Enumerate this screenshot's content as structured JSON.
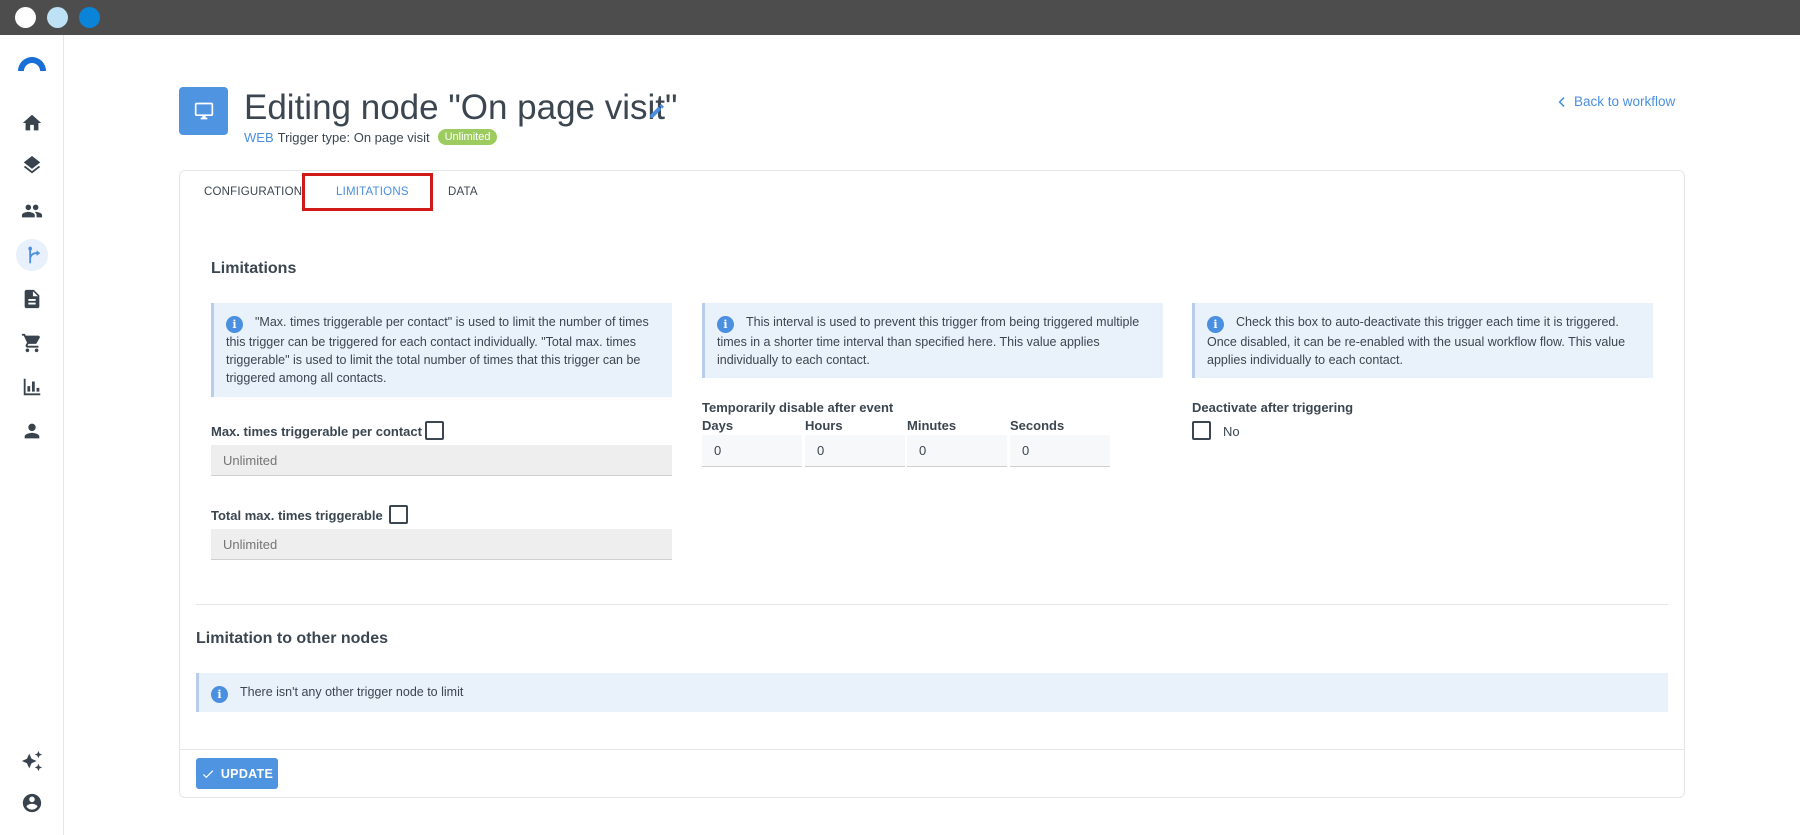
{
  "header": {
    "title": "Editing node \"On page visit\"",
    "channel": "WEB",
    "trigger_type": "Trigger type: On page visit",
    "badge": "Unlimited",
    "back_link": "Back to workflow"
  },
  "tabs": [
    {
      "label": "CONFIGURATION"
    },
    {
      "label": "LIMITATIONS"
    },
    {
      "label": "DATA"
    }
  ],
  "limitations": {
    "title": "Limitations",
    "info_max": "\"Max. times triggerable per contact\" is used to limit the number of times this trigger can be triggered for each contact individually. \"Total max. times triggerable\" is used to limit the total number of times that this trigger can be triggered among all contacts.",
    "info_interval": "This interval is used to prevent this trigger from being triggered multiple times in a shorter time interval than specified here. This value applies individually to each contact.",
    "info_deactivate": "Check this box to auto-deactivate this trigger each time it is triggered. Once disabled, it can be re-enabled with the usual workflow flow. This value applies individually to each contact.",
    "max_per_contact_label": "Max. times triggerable per contact",
    "max_per_contact_placeholder": "Unlimited",
    "total_max_label": "Total max. times triggerable",
    "total_max_placeholder": "Unlimited",
    "temp_disable_label": "Temporarily disable after event",
    "days_label": "Days",
    "hours_label": "Hours",
    "minutes_label": "Minutes",
    "seconds_label": "Seconds",
    "days_value": "0",
    "hours_value": "0",
    "minutes_value": "0",
    "seconds_value": "0",
    "deactivate_label": "Deactivate after triggering",
    "deactivate_value": "No"
  },
  "other_nodes": {
    "title": "Limitation to other nodes",
    "info": "There isn't any other trigger node to limit"
  },
  "footer": {
    "update_label": "UPDATE"
  },
  "colors": {
    "accent": "#4f94e0",
    "badge": "#9ccb5f",
    "highlight": "#d01a1a"
  }
}
